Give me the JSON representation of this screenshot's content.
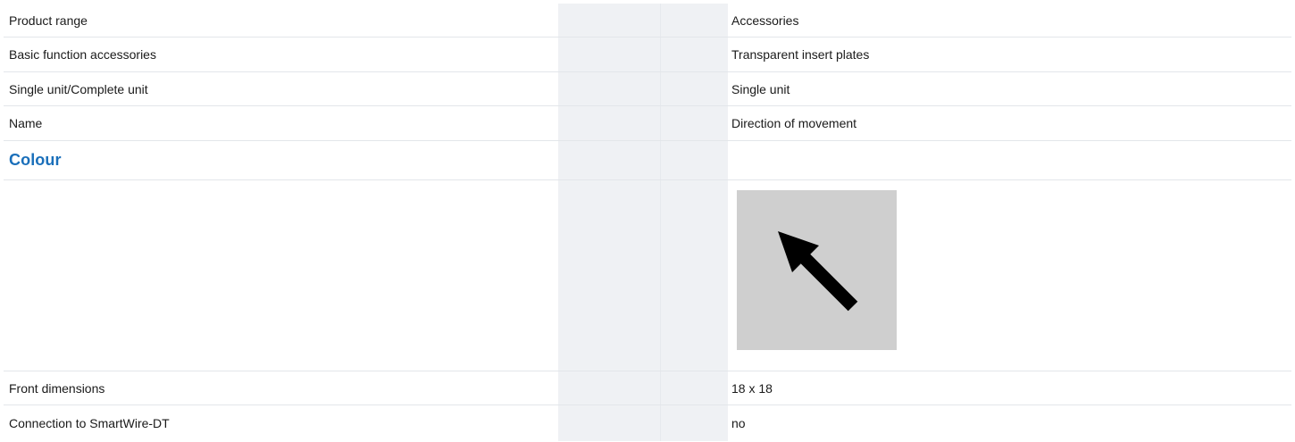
{
  "rows": [
    {
      "label": "Product range",
      "value": "Accessories"
    },
    {
      "label": "Basic function accessories",
      "value": "Transparent insert plates"
    },
    {
      "label": "Single unit/Complete unit",
      "value": "Single unit"
    },
    {
      "label": "Name",
      "value": "Direction of movement"
    }
  ],
  "section": {
    "heading": "Colour"
  },
  "image": {
    "icon": "arrow-up-left-icon",
    "background": "#cfcfcf",
    "arrow_color": "#000000"
  },
  "rows_after": [
    {
      "label": "Front dimensions",
      "value": "18 x 18"
    },
    {
      "label": "Connection to SmartWire-DT",
      "value": "no"
    }
  ],
  "colors": {
    "heading": "#1a6fba",
    "shaded_column": "#eff1f4",
    "row_divider": "#e3e6ea"
  }
}
